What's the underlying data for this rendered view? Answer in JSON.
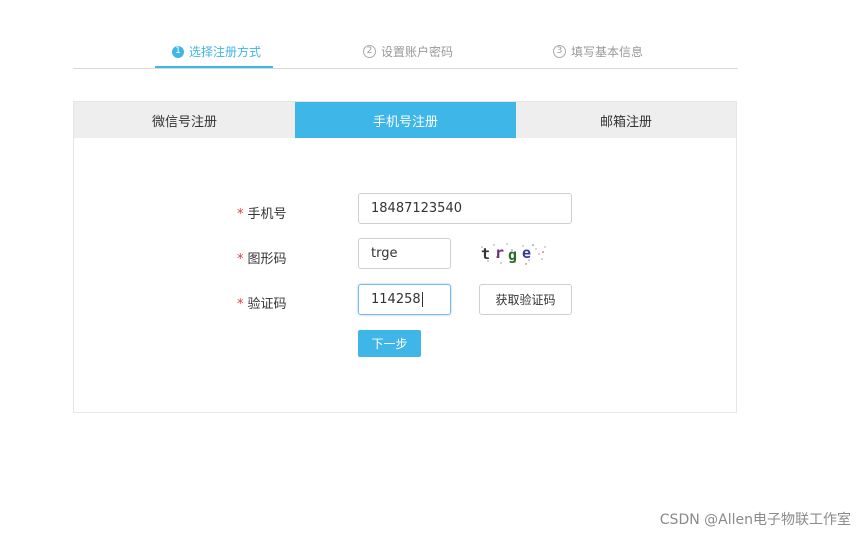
{
  "steps": [
    {
      "num": "1",
      "label": "选择注册方式"
    },
    {
      "num": "2",
      "label": "设置账户密码"
    },
    {
      "num": "3",
      "label": "填写基本信息"
    }
  ],
  "tabs": [
    {
      "label": "微信号注册"
    },
    {
      "label": "手机号注册"
    },
    {
      "label": "邮箱注册"
    }
  ],
  "form": {
    "required_mark": "*",
    "phone_label": "手机号",
    "phone_value": "18487123540",
    "captcha_label": "图形码",
    "captcha_value": "trge",
    "captcha_image_text": "trge",
    "code_label": "验证码",
    "code_value": "114258",
    "get_code_button": "获取验证码",
    "next_button": "下一步"
  },
  "watermark": "CSDN @Allen电子物联工作室",
  "colors": {
    "accent": "#3fb6e8",
    "required": "#e2383d"
  }
}
